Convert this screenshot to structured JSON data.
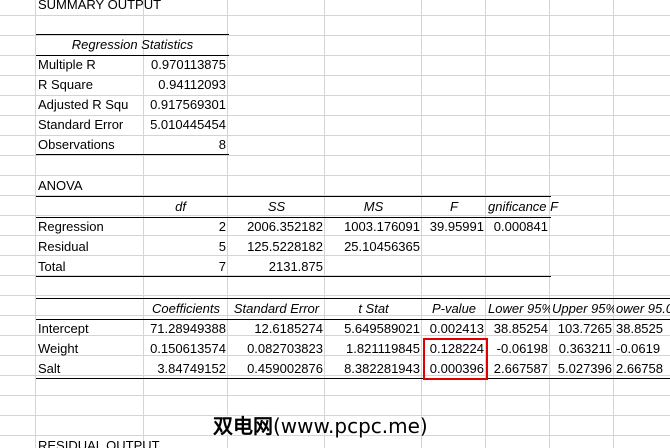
{
  "title": "SUMMARY OUTPUT",
  "regression_statistics": {
    "header": "Regression Statistics",
    "rows": [
      {
        "label": "Multiple R",
        "value": "0.970113875"
      },
      {
        "label": "R Square",
        "value": "0.94112093"
      },
      {
        "label": "Adjusted R Squ",
        "value": "0.917569301"
      },
      {
        "label": "Standard Error",
        "value": "5.010445454"
      },
      {
        "label": "Observations",
        "value": "8"
      }
    ]
  },
  "anova": {
    "title": "ANOVA",
    "headers": [
      "df",
      "SS",
      "MS",
      "F",
      "gnificance F"
    ],
    "rows": [
      {
        "label": "Regression",
        "df": "2",
        "ss": "2006.352182",
        "ms": "1003.176091",
        "f": "39.95991",
        "sig": "0.000841"
      },
      {
        "label": "Residual",
        "df": "5",
        "ss": "125.5228182",
        "ms": "25.10456365",
        "f": "",
        "sig": ""
      },
      {
        "label": "Total",
        "df": "7",
        "ss": "2131.875",
        "ms": "",
        "f": "",
        "sig": ""
      }
    ]
  },
  "coefficients": {
    "headers": [
      "Coefficients",
      "Standard Error",
      "t Stat",
      "P-value",
      "Lower 95%",
      "Upper 95%",
      "ower 95.0"
    ],
    "rows": [
      {
        "label": "Intercept",
        "coef": "71.28949388",
        "se": "12.6185274",
        "t": "5.649589021",
        "p": "0.002413",
        "lo": "38.85254",
        "hi": "103.7265",
        "lo2": "38.8525"
      },
      {
        "label": "Weight",
        "coef": "0.150613574",
        "se": "0.082703823",
        "t": "1.821119845",
        "p": "0.128224",
        "lo": "-0.06198",
        "hi": "0.363211",
        "lo2": "-0.0619"
      },
      {
        "label": "Salt",
        "coef": "3.84749152",
        "se": "0.459002876",
        "t": "8.382281943",
        "p": "0.000396",
        "lo": "2.667587",
        "hi": "5.027396",
        "lo2": "2.66758"
      }
    ]
  },
  "residual_title": "RESIDUAL OUTPUT",
  "watermark": {
    "cjk": "双电网",
    "url": "(www.pcpc.me)"
  },
  "colors": {
    "highlight": "#e00000",
    "gridline": "#d4d4d4"
  }
}
